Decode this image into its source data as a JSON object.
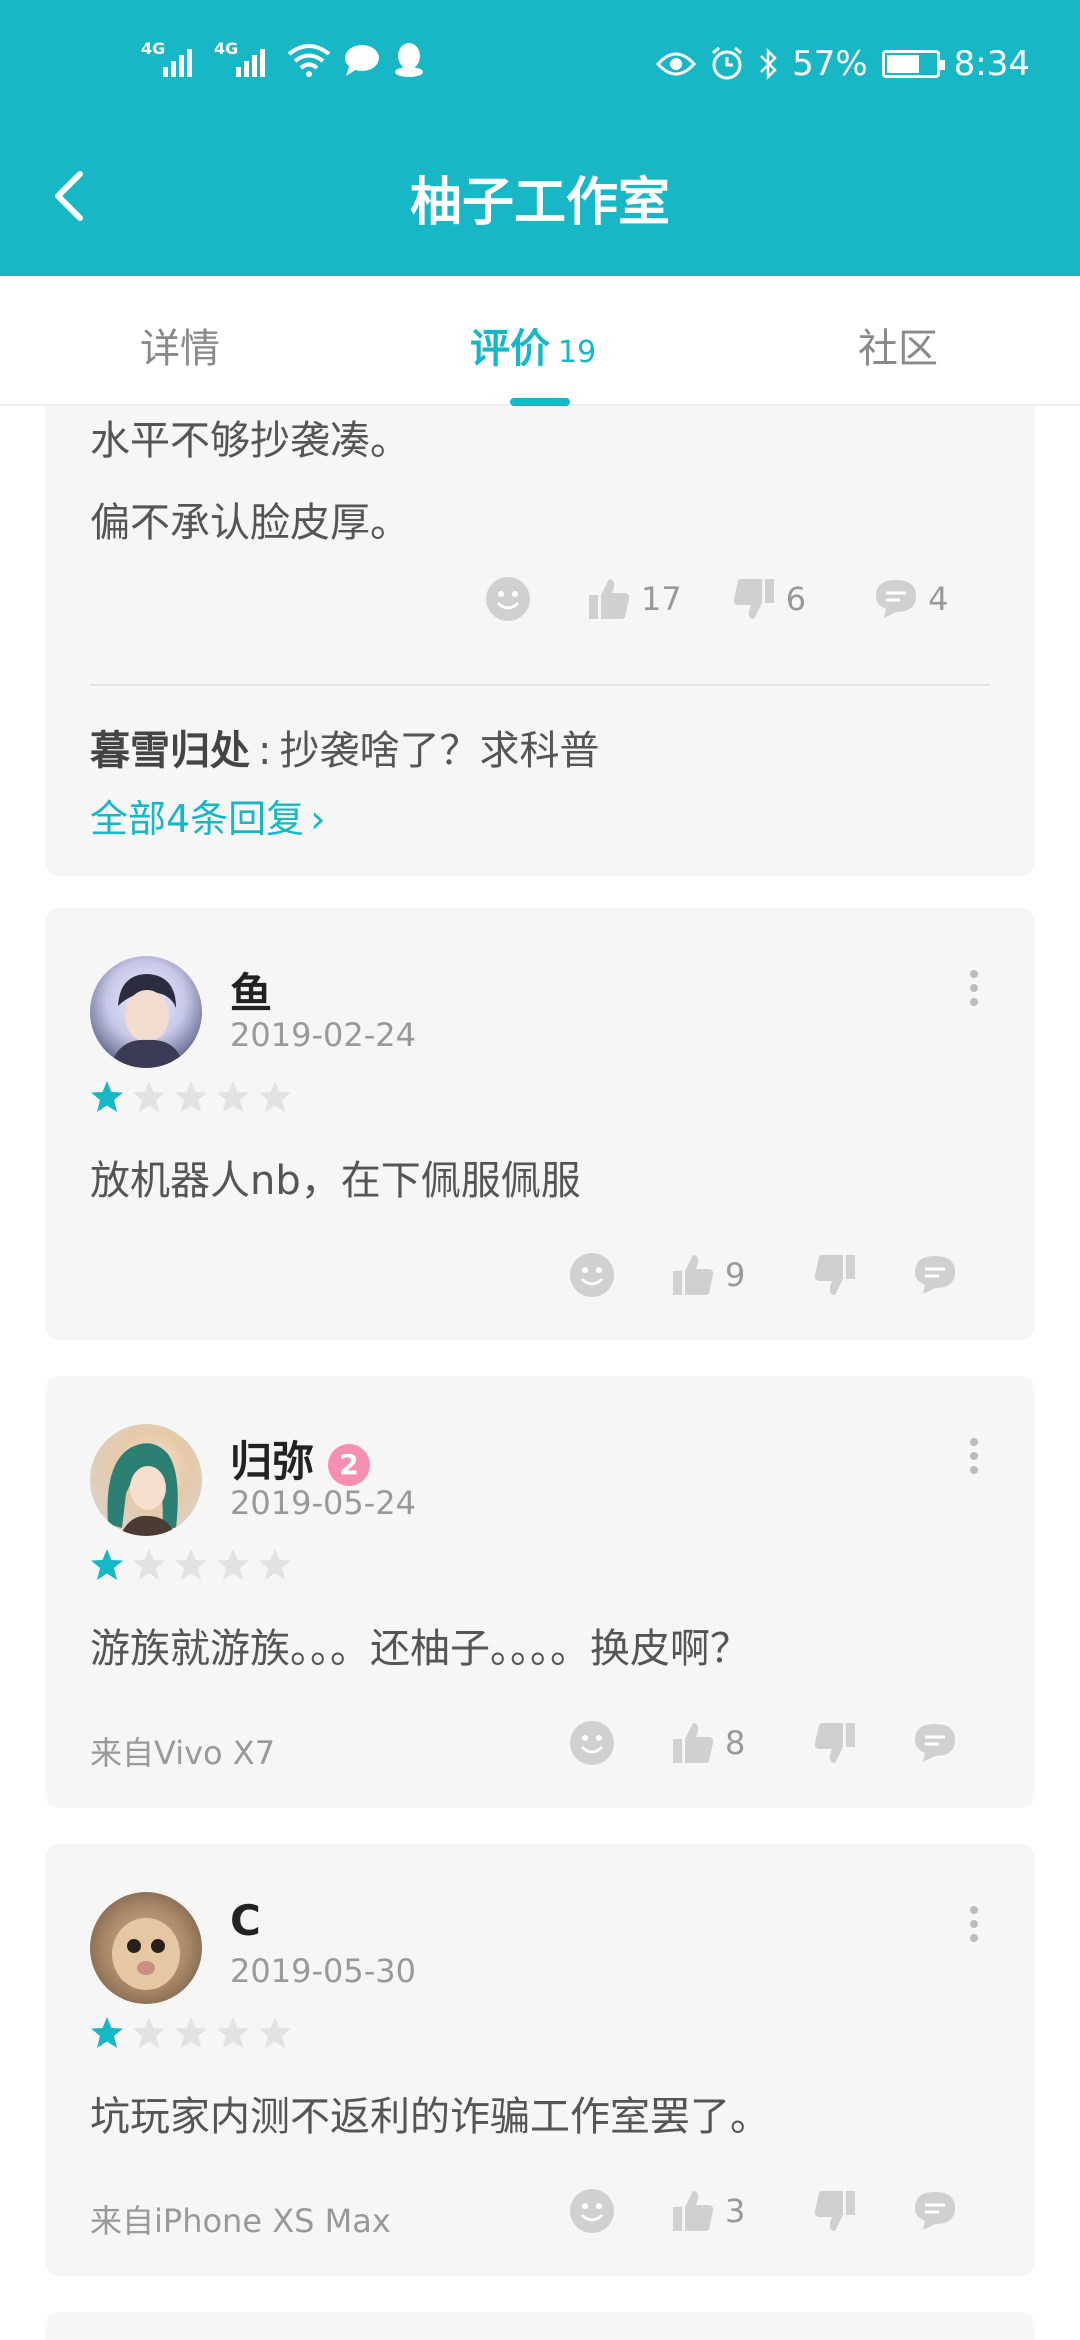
{
  "status_bar": {
    "signal1": "4G",
    "signal2": "4G",
    "battery_percent": "57%",
    "time": "8:34"
  },
  "header": {
    "title": "柚子工作室"
  },
  "tabs": [
    {
      "label": "详情"
    },
    {
      "label": "评价",
      "count": "19"
    },
    {
      "label": "社区"
    }
  ],
  "first_review": {
    "text_line1": "水平不够抄袭凑。",
    "text_line2": "偏不承认脸皮厚。",
    "likes": "17",
    "dislikes": "6",
    "comments": "4",
    "reply_author": "暮雪归处",
    "reply_sep": ":",
    "reply_text": "抄袭啥了？求科普",
    "all_replies": "全部4条回复"
  },
  "reviews": [
    {
      "name": "鱼",
      "date": "2019-02-24",
      "rating": 1,
      "text": "放机器人nb，在下佩服佩服",
      "likes": "9",
      "device": ""
    },
    {
      "name": "归弥",
      "badge": "2",
      "date": "2019-05-24",
      "rating": 1,
      "text": "游族就游族。。。还柚子。。。。换皮啊？",
      "likes": "8",
      "device": "来自Vivo X7"
    },
    {
      "name": "C",
      "date": "2019-05-30",
      "rating": 1,
      "text": "坑玩家内测不返利的诈骗工作室罢了。",
      "likes": "3",
      "device": "来自iPhone XS Max"
    }
  ],
  "colors": {
    "accent": "#17b7c6",
    "card_bg": "#f6f6f6",
    "icon_gray": "#c9c9c9"
  }
}
